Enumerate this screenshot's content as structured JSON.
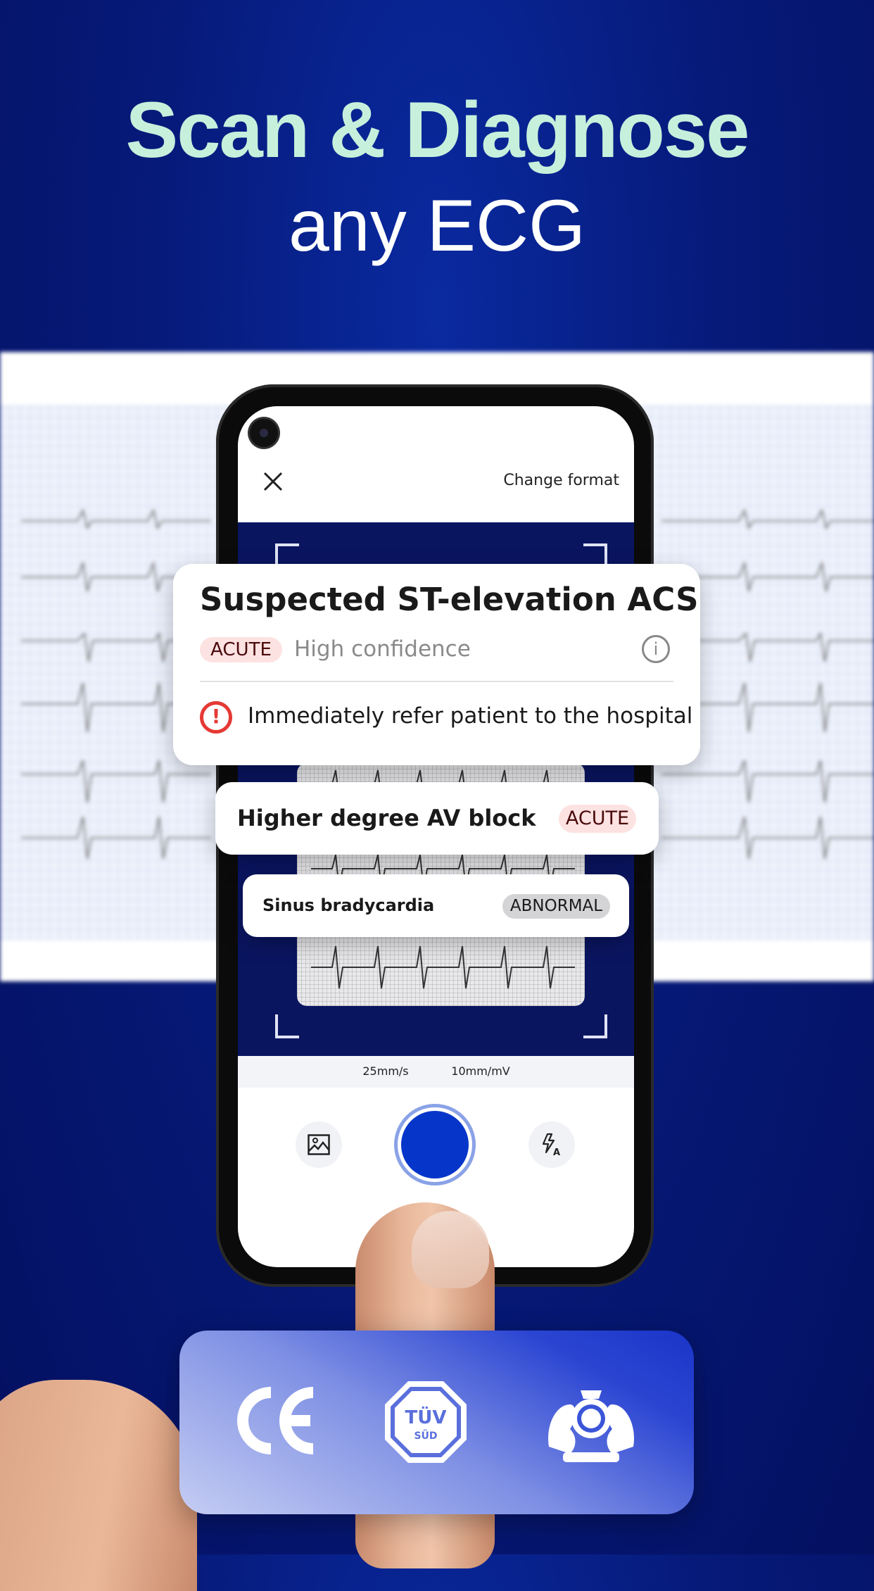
{
  "headline": {
    "line1": "Scan & Diagnose",
    "line2": "any ECG"
  },
  "camera_screen": {
    "change_format_label": "Change format",
    "close_icon": "close-icon",
    "paper_speed": "25mm/s",
    "amplitude": "10mm/mV",
    "gallery_icon": "image-icon",
    "flash_icon": "flash-auto-icon"
  },
  "results": {
    "primary": {
      "title": "Suspected ST-elevation ACS",
      "badge": "ACUTE",
      "confidence": "High confidence",
      "advice": "Immediately refer patient to the hospital"
    },
    "secondary": {
      "title": "Higher degree AV block",
      "badge": "ACUTE"
    },
    "tertiary": {
      "title": "Sinus bradycardia",
      "badge": "ABNORMAL"
    }
  },
  "certifications": {
    "ce": "CE",
    "tuv": "TÜV",
    "tuv_sub": "SÜD",
    "crest": "royal-coat-of-arms"
  },
  "colors": {
    "accent": "#0636c9",
    "acute_badge": "#fde2e2",
    "abnormal_badge": "#d4d4d6",
    "alert": "#e53935",
    "background": "#061a7a",
    "headline": "#c6f0dc"
  }
}
